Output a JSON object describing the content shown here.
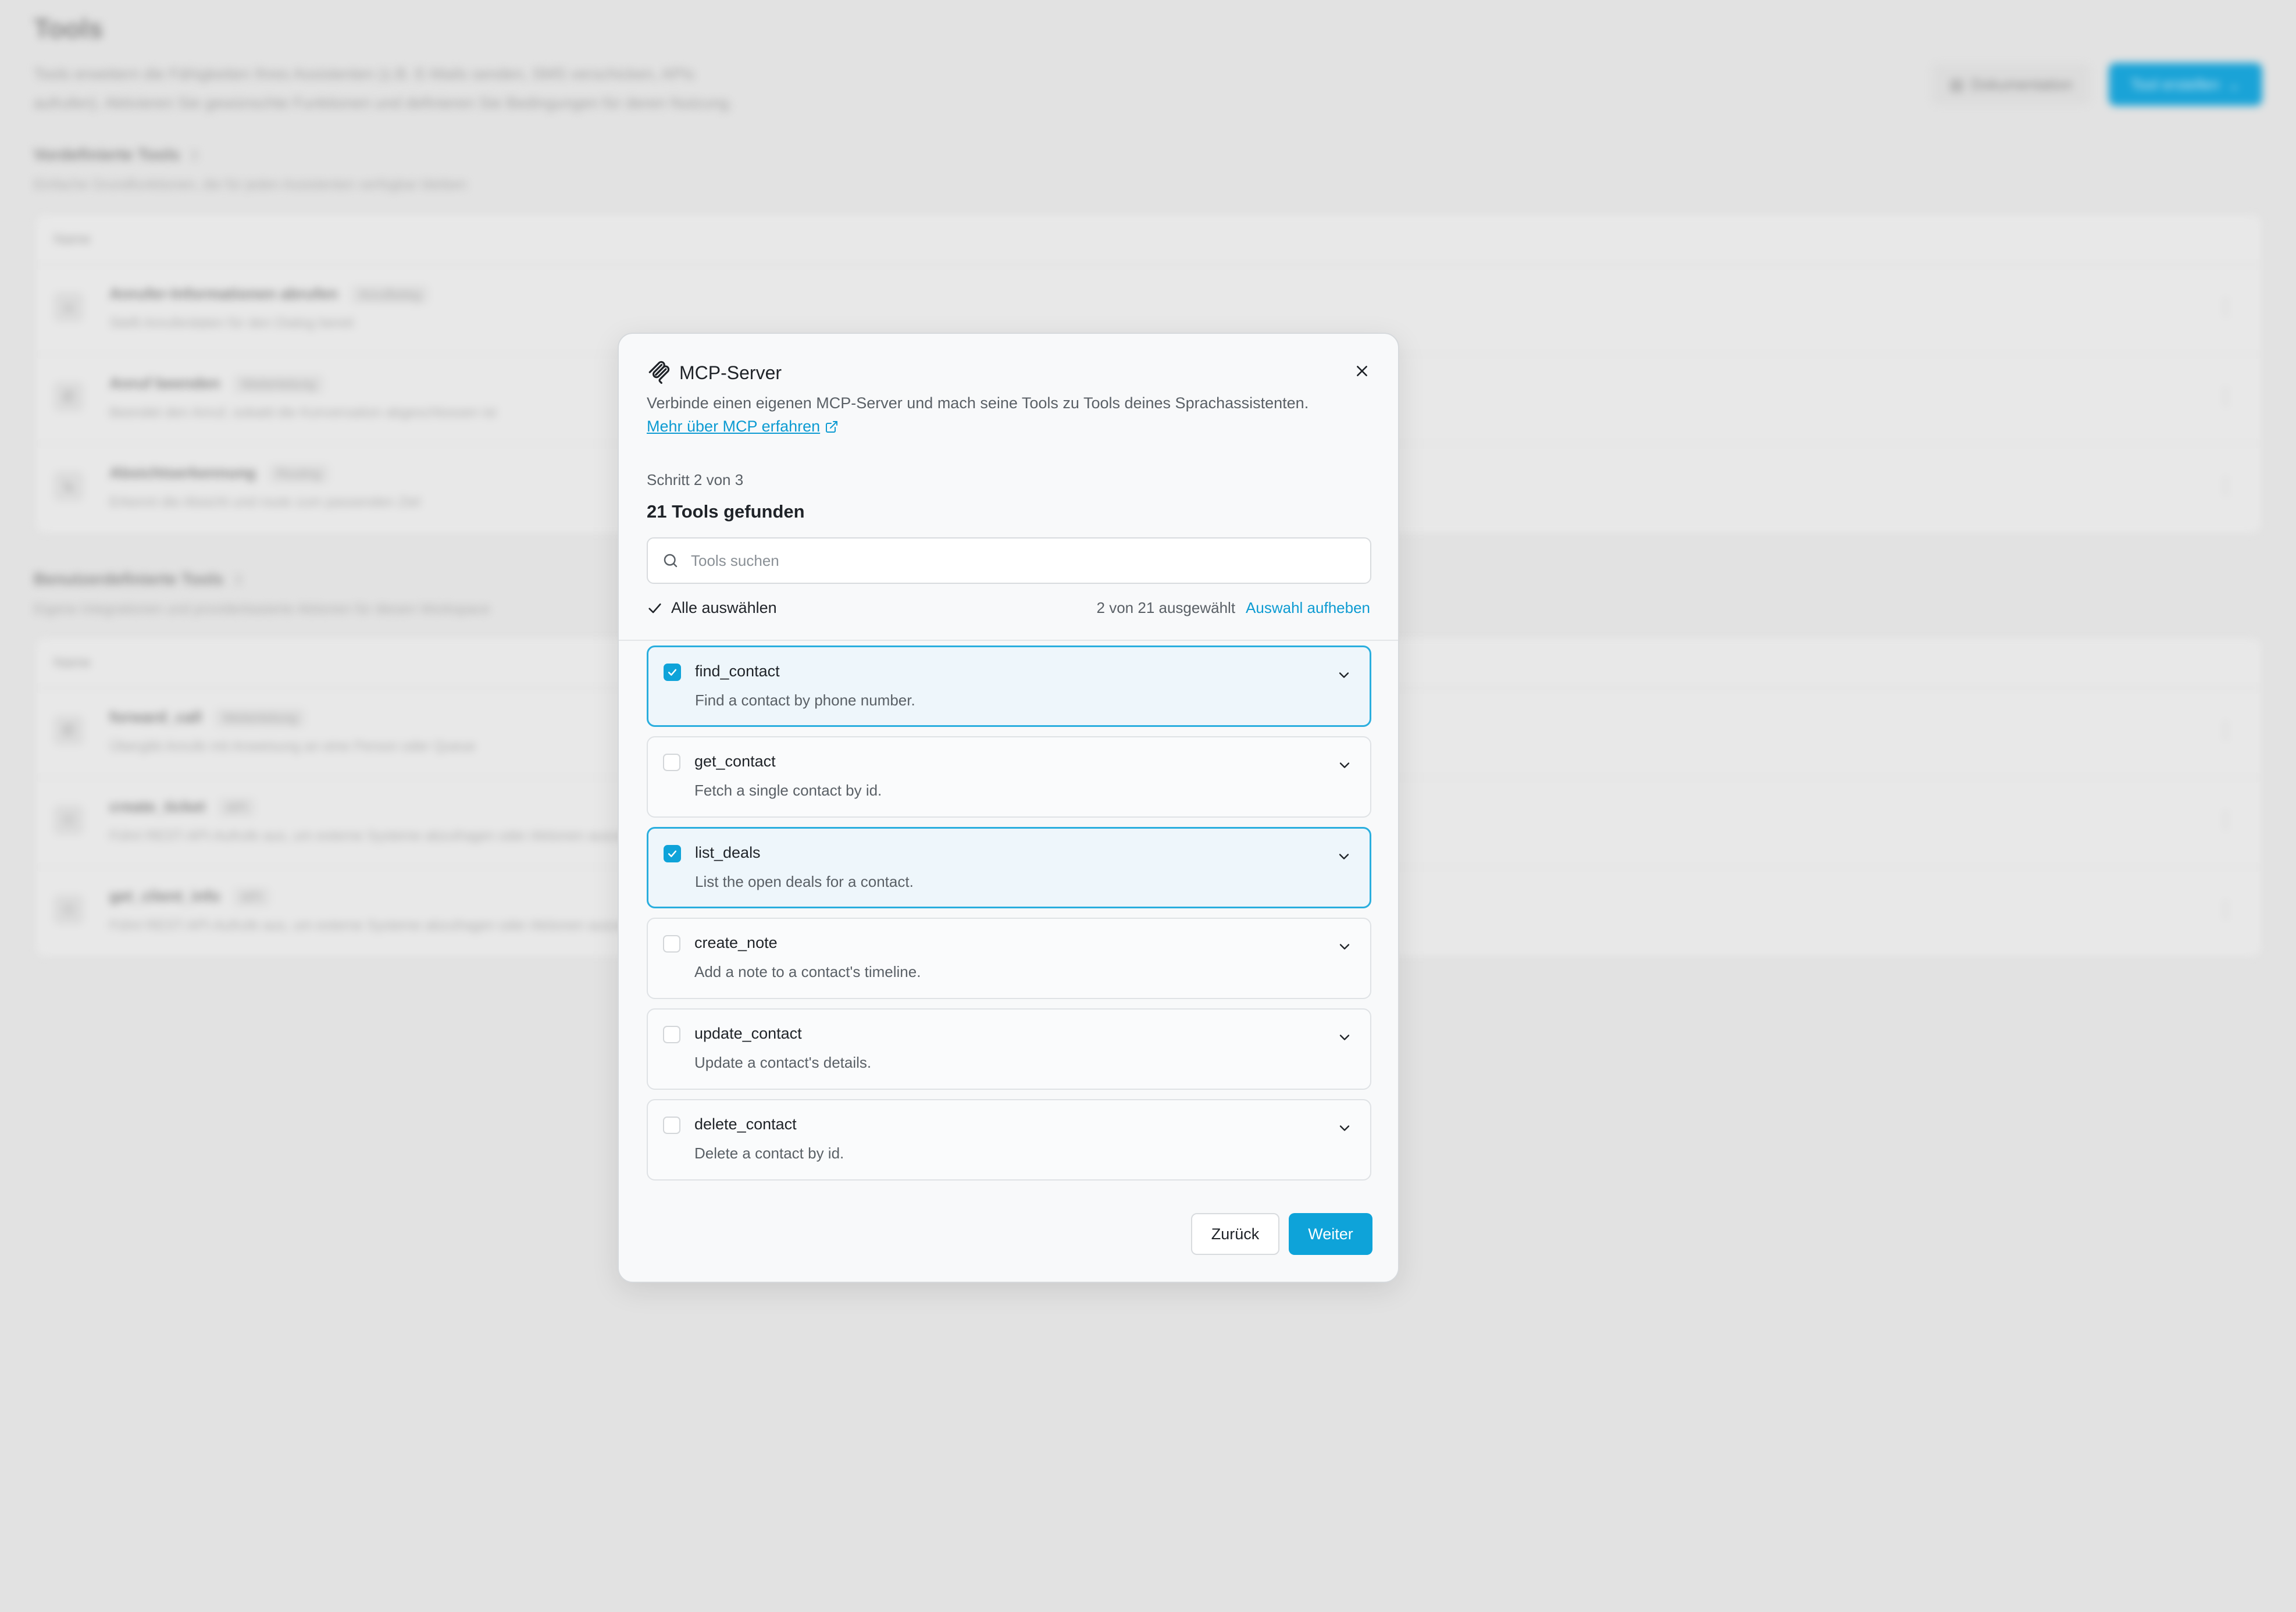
{
  "background": {
    "title": "Tools",
    "intro_line1": "Tools erweitern die Fähigkeiten Ihres Assistenten (z.B. E-Mails senden, SMS verschicken, APIs",
    "intro_line2": "aufrufen). Aktivieren Sie gewünschte Funktionen und definieren Sie Bedingungen für deren Nutzung.",
    "doc_button": "Dokumentation",
    "create_button": "Tool erstellen",
    "predefined": {
      "title": "Vordefinierte Tools",
      "count": "3",
      "subtitle": "Einfache Grundfunktionen, die für jeden Assistenten verfügbar bleiben",
      "column_name": "Name",
      "rows": [
        {
          "name": "Anrufer-Informationen abrufen",
          "badge": "Anrufbeleg",
          "desc": "Stellt Anruferdaten für den Dialog bereit"
        },
        {
          "name": "Anruf beenden",
          "badge": "Weiterleitung",
          "desc": "Beendet den Anruf, sobald die Konversation abgeschlossen ist"
        },
        {
          "name": "Absichtserkennung",
          "badge": "Routing",
          "desc": "Erkennt die Absicht und route zum passenden Ziel"
        }
      ]
    },
    "custom": {
      "title": "Benutzerdefinierte Tools",
      "count": "3",
      "subtitle": "Eigene Integrationen und providerbasierte Aktionen für diesen Workspace",
      "column_name": "Name",
      "rows": [
        {
          "name": "forward_call",
          "badge": "Weiterleitung",
          "desc": "Übergibt Anrufe mit Anweisung an eine Person oder Queue"
        },
        {
          "name": "create_ticket",
          "badge": "API",
          "desc": "Führt REST-API-Aufrufe aus, um externe Systeme abzufragen oder Aktionen auszulösen"
        },
        {
          "name": "get_client_info",
          "badge": "API",
          "desc": "Führt REST-API-Aufrufe aus, um externe Systeme abzufragen oder Aktionen auszulösen"
        }
      ]
    }
  },
  "modal": {
    "title": "MCP-Server",
    "description": "Verbinde einen eigenen MCP-Server und mach seine Tools zu Tools deines Sprachassistenten.",
    "learn_more": "Mehr über MCP erfahren",
    "step": "Schritt 2 von 3",
    "found": "21 Tools gefunden",
    "search_placeholder": "Tools suchen",
    "select_all": "Alle auswählen",
    "selection_count": "2 von 21 ausgewählt",
    "clear_selection": "Auswahl aufheben",
    "tools": [
      {
        "name": "find_contact",
        "desc": "Find a contact by phone number.",
        "selected": true
      },
      {
        "name": "get_contact",
        "desc": "Fetch a single contact by id.",
        "selected": false
      },
      {
        "name": "list_deals",
        "desc": "List the open deals for a contact.",
        "selected": true
      },
      {
        "name": "create_note",
        "desc": "Add a note to a contact's timeline.",
        "selected": false
      },
      {
        "name": "update_contact",
        "desc": "Update a contact's details.",
        "selected": false
      },
      {
        "name": "delete_contact",
        "desc": "Delete a contact by id.",
        "selected": false
      }
    ],
    "back_button": "Zurück",
    "next_button": "Weiter"
  },
  "colors": {
    "accent": "#0ea3d9",
    "selected_border": "#2aaede",
    "selected_bg": "#eef6fb",
    "overlay": "#e2e2e2"
  },
  "icons": {
    "modal_header": "mcp-logo-icon",
    "close": "close-icon",
    "external_link": "external-link-icon",
    "search": "search-icon",
    "select_all": "check-icon",
    "tool_expand": "chevron-down-icon"
  }
}
